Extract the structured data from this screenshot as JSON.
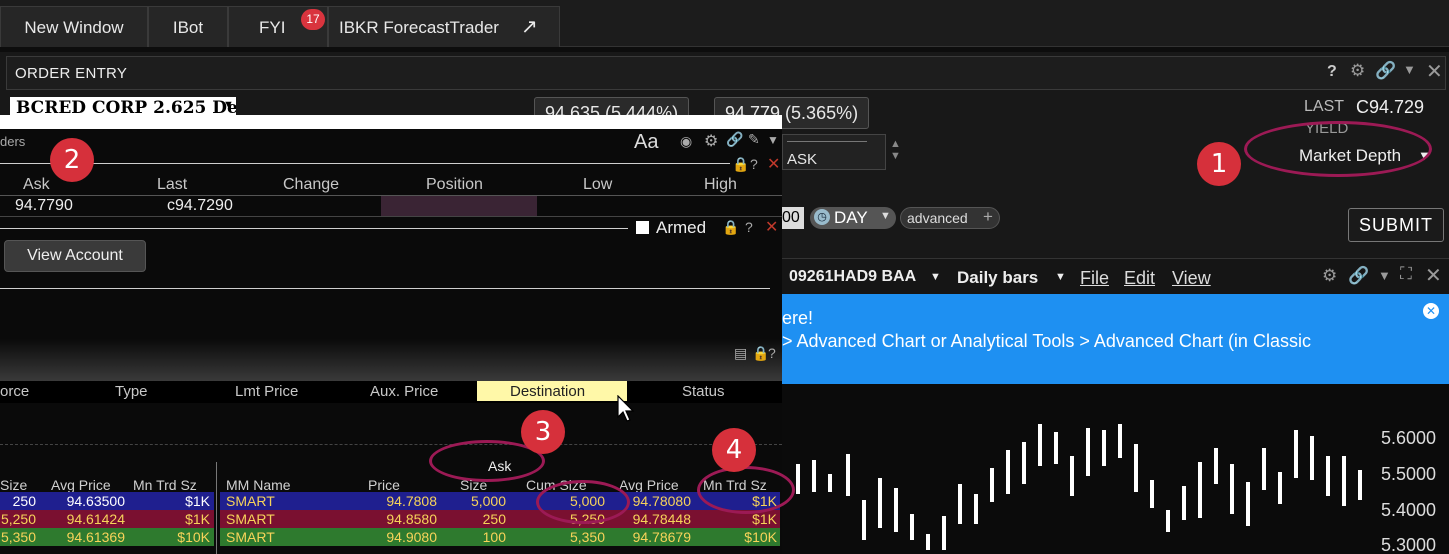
{
  "tabs": {
    "new_window": "New Window",
    "ibot": "IBot",
    "fyi": "FYI",
    "fyi_badge": "17",
    "forecast": "IBKR ForecastTrader",
    "forecast_icon": "external-link-arrow"
  },
  "order_entry": {
    "title": "ORDER ENTRY",
    "symbol": "BCRED CORP 2.625 De",
    "bid_quote": "94.635 (5.444%)",
    "ask_quote": "94.779 (5.365%)",
    "last_label": "LAST",
    "last_value": "C94.729",
    "yield_label": "YIELD",
    "market_depth": "Market Depth",
    "action_value": "ASK",
    "qty_tail": "00",
    "tif": "DAY",
    "advanced": "advanced",
    "submit": "SUBMIT"
  },
  "overlay": {
    "title_fragment": "ders",
    "font_label": "Aa",
    "columns": [
      "Ask",
      "Last",
      "Change",
      "Position",
      "Low",
      "High"
    ],
    "row": {
      "ask": "94.7790",
      "last": "c94.7290"
    },
    "armed_label": "Armed",
    "view_account": "View Account",
    "order_columns": [
      "orce",
      "Type",
      "Lmt Price",
      "Aux. Price",
      "Destination",
      "Status"
    ]
  },
  "depth": {
    "ask_title": "Ask",
    "bid_headers": [
      "Size",
      "Avg Price",
      "Mn Trd Sz"
    ],
    "ask_headers": [
      "MM Name",
      "Price",
      "Size",
      "Cum Size",
      "Avg Price",
      "Mn Trd Sz"
    ],
    "bid_rows": [
      {
        "size": "250",
        "avg": "94.63500",
        "mn": "$1K"
      },
      {
        "size": "5,250",
        "avg": "94.61424",
        "mn": "$1K"
      },
      {
        "size": "5,350",
        "avg": "94.61369",
        "mn": "$10K"
      }
    ],
    "ask_rows": [
      {
        "mm": "SMART",
        "price": "94.7808",
        "size": "5,000",
        "cum": "5,000",
        "avg": "94.78080",
        "mn": "$1K"
      },
      {
        "mm": "SMART",
        "price": "94.8580",
        "size": "250",
        "cum": "5,250",
        "avg": "94.78448",
        "mn": "$1K"
      },
      {
        "mm": "SMART",
        "price": "94.9080",
        "size": "100",
        "cum": "5,350",
        "avg": "94.78679",
        "mn": "$10K"
      }
    ],
    "row_colors": [
      "#1f1f8f",
      "#7a1030",
      "#2e7a2e"
    ]
  },
  "callouts": [
    "1",
    "2",
    "3",
    "4"
  ],
  "chart": {
    "symbol": "09261HAD9 BAA",
    "bar_type": "Daily bars",
    "menu_file": "File",
    "menu_edit": "Edit",
    "menu_view": "View",
    "banner_line1": "ere!",
    "banner_line2": "> Advanced Chart or Analytical Tools > Advanced Chart (in Classic",
    "y_ticks": [
      "5.6000",
      "5.5000",
      "5.4000",
      "5.3000"
    ]
  }
}
